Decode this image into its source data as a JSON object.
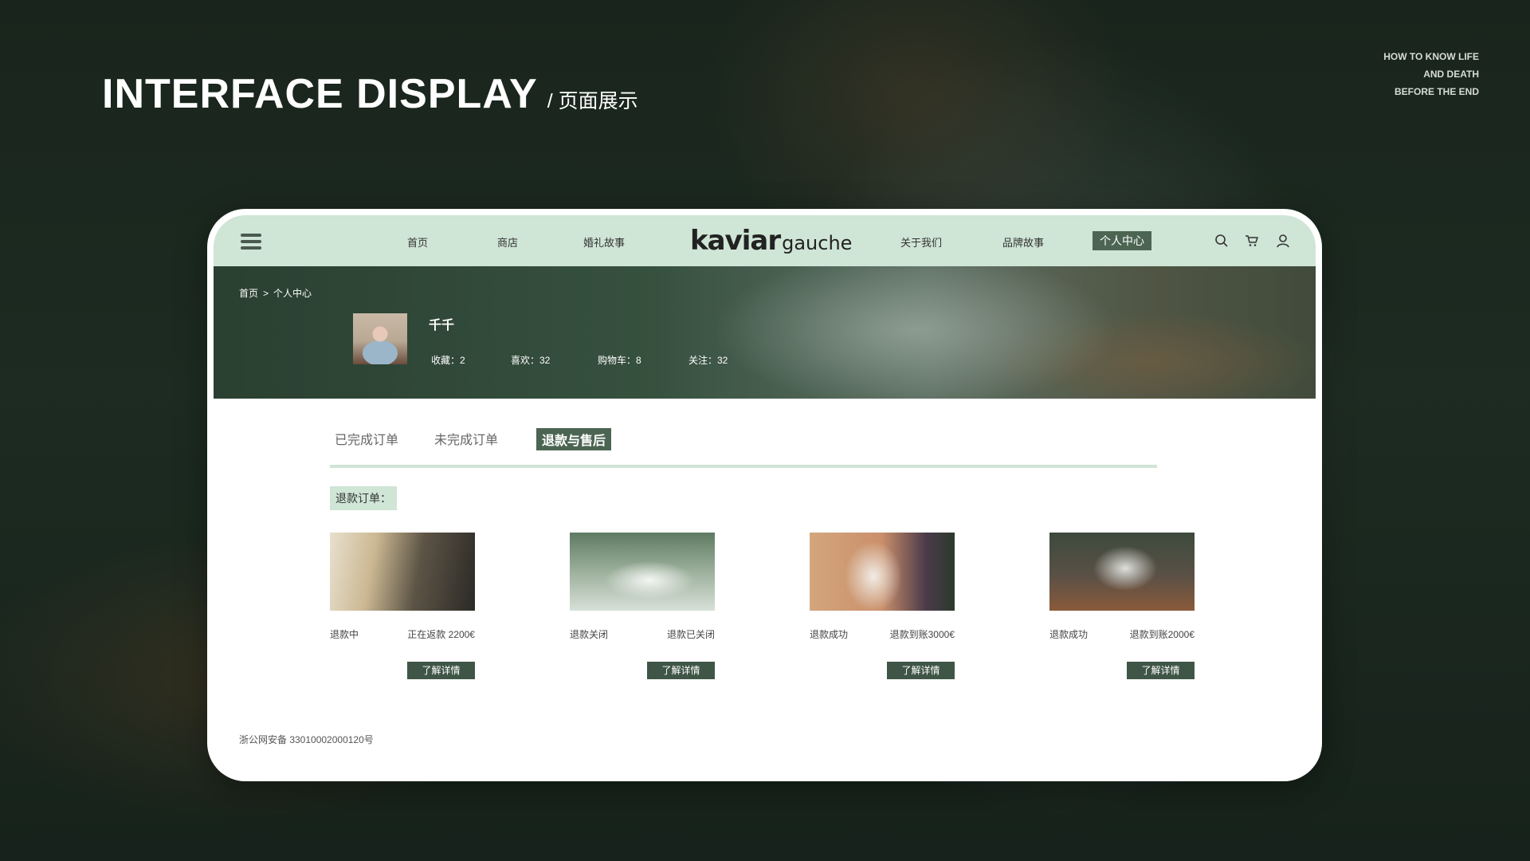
{
  "hero": {
    "title": "INTERFACE DISPLAY",
    "subtitle": "/ 页面展示",
    "tagline": [
      "HOW TO KNOW LIFE",
      "AND DEATH",
      "BEFORE THE END"
    ]
  },
  "nav": {
    "links": [
      "首页",
      "商店",
      "婚礼故事",
      "关于我们",
      "品牌故事",
      "个人中心"
    ],
    "active": "个人中心",
    "logo_primary": "kaviar",
    "logo_secondary": "gauche",
    "icons": [
      "menu-icon",
      "search-icon",
      "cart-icon",
      "user-icon"
    ]
  },
  "profile": {
    "breadcrumb": [
      "首页",
      "个人中心"
    ],
    "breadcrumb_separator": ">",
    "username": "千千",
    "stats": [
      "收藏：2",
      "喜欢：32",
      "购物车：8",
      "关注：32"
    ]
  },
  "tabs": {
    "items": [
      "已完成订单",
      "未完成订单",
      "退款与售后"
    ],
    "active": "退款与售后"
  },
  "section": {
    "label": "退款订单："
  },
  "orders": [
    {
      "status": "退款中",
      "amount": "正在返款 2200€",
      "button": "了解详情"
    },
    {
      "status": "退款关闭",
      "amount": "退款已关闭",
      "button": "了解详情"
    },
    {
      "status": "退款成功",
      "amount": "退款到账3000€",
      "button": "了解详情"
    },
    {
      "status": "退款成功",
      "amount": "退款到账2000€",
      "button": "了解详情"
    }
  ],
  "footer": {
    "text": "浙公网安备 33010002000120号"
  },
  "colors": {
    "nav_bg": "#cfe5d6",
    "accent": "#4c6553",
    "button": "#3f5647"
  }
}
